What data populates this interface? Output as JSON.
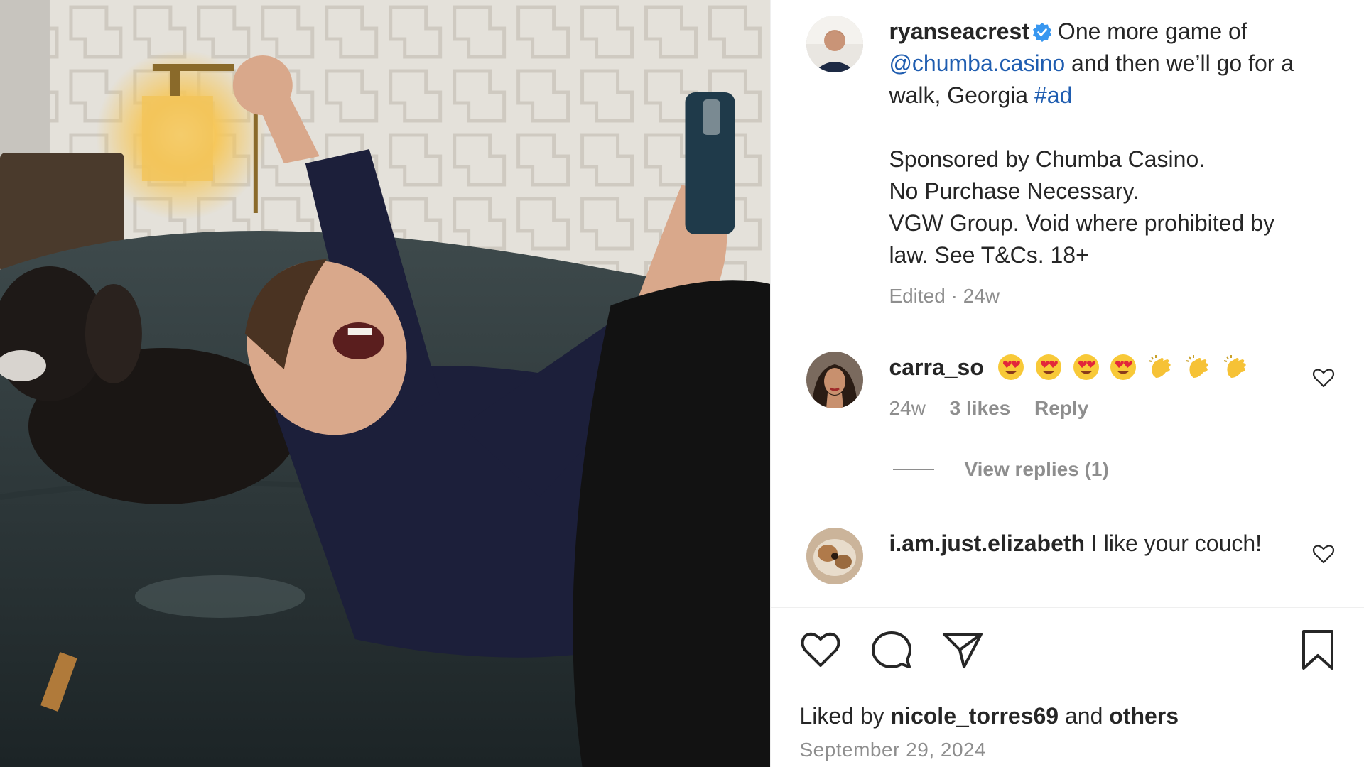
{
  "post": {
    "username": "ryanseacrest",
    "verified_icon": "verified-badge-icon",
    "caption": {
      "text_1": "One more game of",
      "mention": "@chumba.casino",
      "text_2": "and then we’ll go for a walk, Georgia",
      "hashtag": "#ad",
      "sponsor_lines": [
        "Sponsored by Chumba Casino.",
        "No Purchase Necessary.",
        "VGW Group. Void where prohibited by law. See T&Cs. 18+"
      ]
    },
    "meta": "Edited · 24w"
  },
  "comments": [
    {
      "username": "carra_so",
      "emojis": [
        "heart-eyes",
        "heart-eyes",
        "heart-eyes",
        "heart-eyes",
        "clapping",
        "clapping",
        "clapping"
      ],
      "time": "24w",
      "likes": "3 likes",
      "reply": "Reply",
      "view_replies": "View replies (1)"
    },
    {
      "username": "i.am.just.elizabeth",
      "text": "I like your couch!"
    }
  ],
  "actions": {
    "like_icon": "heart-icon",
    "comment_icon": "comment-icon",
    "share_icon": "share-icon",
    "save_icon": "bookmark-icon"
  },
  "likes": {
    "prefix": "Liked by",
    "user": "nicole_torres69",
    "middle": "and",
    "others": "others"
  },
  "date": "September 29, 2024",
  "colors": {
    "link": "#1f5db0",
    "verified": "#3897f0",
    "muted": "#8e8e8e"
  }
}
